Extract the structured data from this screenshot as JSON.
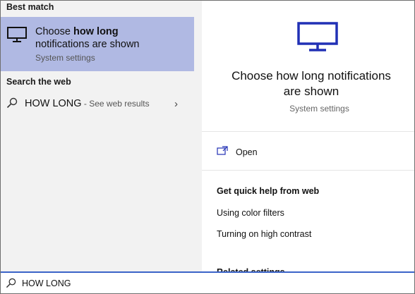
{
  "left": {
    "best_match_header": "Best match",
    "best_match": {
      "title_prefix": "Choose ",
      "title_bold": "how long",
      "title_rest": "notifications are shown",
      "subtitle": "System settings",
      "icon": "monitor-icon"
    },
    "search_web_header": "Search the web",
    "web_result": {
      "query": "HOW LONG",
      "suffix": " - See web results",
      "icon": "search-icon",
      "chevron": "›"
    }
  },
  "right": {
    "icon": "monitor-icon",
    "title": "Choose how long notifications are shown",
    "subtitle": "System settings",
    "open_label": "Open",
    "open_icon": "open-window-icon",
    "quick_help_header": "Get quick help from web",
    "help_links": [
      "Using color filters",
      "Turning on high contrast"
    ],
    "cut_off_header": "Related settings"
  },
  "search_box": {
    "value": "HOW LONG",
    "icon": "search-icon"
  },
  "colors": {
    "accent": "#2130b5",
    "selection": "#b0b9e3",
    "search_border": "#3a63c8"
  }
}
